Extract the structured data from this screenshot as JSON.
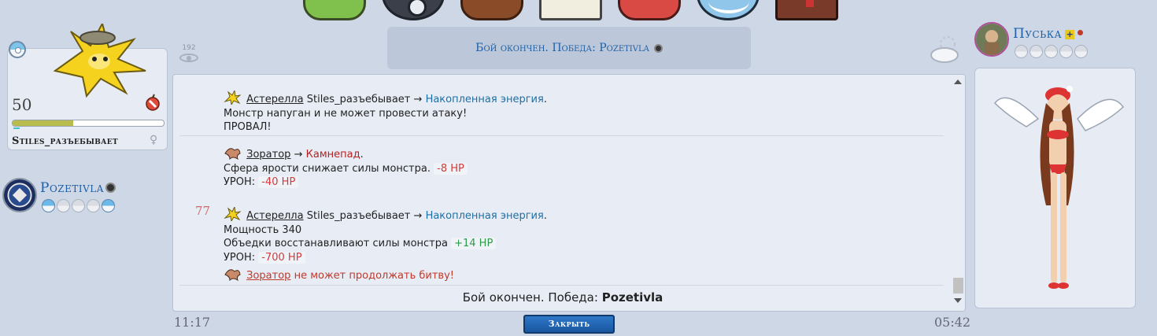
{
  "nav": {
    "icons": [
      "pokedex-icon",
      "pokeball-icon",
      "backpack-icon",
      "mail-icon",
      "shop-icon",
      "map-icon",
      "trainer-card-icon"
    ]
  },
  "left_monster": {
    "level": "50",
    "name": "Stiles_разъебывает",
    "hp_fraction": 0.4,
    "gender_icon": "♀"
  },
  "left_player": {
    "name": "Pozetivla",
    "team": [
      true,
      false,
      false,
      false,
      true
    ]
  },
  "header": {
    "result": "Бой окончен. Победа: Pozetivla"
  },
  "viewers": {
    "count": "192"
  },
  "log": {
    "turn_number": "77",
    "entries": [
      {
        "monster": "Астерелла",
        "attacker": "Stiles_разъебывает",
        "arrow": "→",
        "move": "Накопленная энергия",
        "line2": "Монстр напуган и не может провести атаку!",
        "line3": "ПРОВАЛ!"
      },
      {
        "monster": "Зоратор",
        "arrow": "→",
        "move": "Камнепад",
        "line2": "Сфера ярости снижает силы монстра.",
        "line2_hp": "-8 HP",
        "line3_label": "УРОН:",
        "line3_hp": "-40 HP"
      },
      {
        "monster": "Астерелла",
        "attacker": "Stiles_разъебывает",
        "arrow": "→",
        "move": "Накопленная энергия",
        "line2": "Мощность 340",
        "line3": "Объедки восстанавливают силы монстра",
        "line3_hp": "+14 HP",
        "line4_label": "УРОН:",
        "line4_hp": "-700 HP"
      },
      {
        "monster": "Зоратор",
        "text": "не может продолжать битву!"
      }
    ],
    "footer_prefix": "Бой окончен. Победа:",
    "footer_winner": "Pozetivla"
  },
  "timer": {
    "left": "11:17",
    "right": "05:42"
  },
  "close_button": "Закрыть",
  "right_player": {
    "name": "Пуська",
    "badge": "+",
    "team": [
      false,
      false,
      false,
      false,
      false
    ]
  },
  "colors": {
    "background": "#cdd7e6",
    "player_name": "#1e5fa5",
    "hp_negative": "#d33a3a",
    "hp_positive": "#2e9a4a",
    "move_blue": "#1e6fa5",
    "move_red": "#b52020"
  }
}
